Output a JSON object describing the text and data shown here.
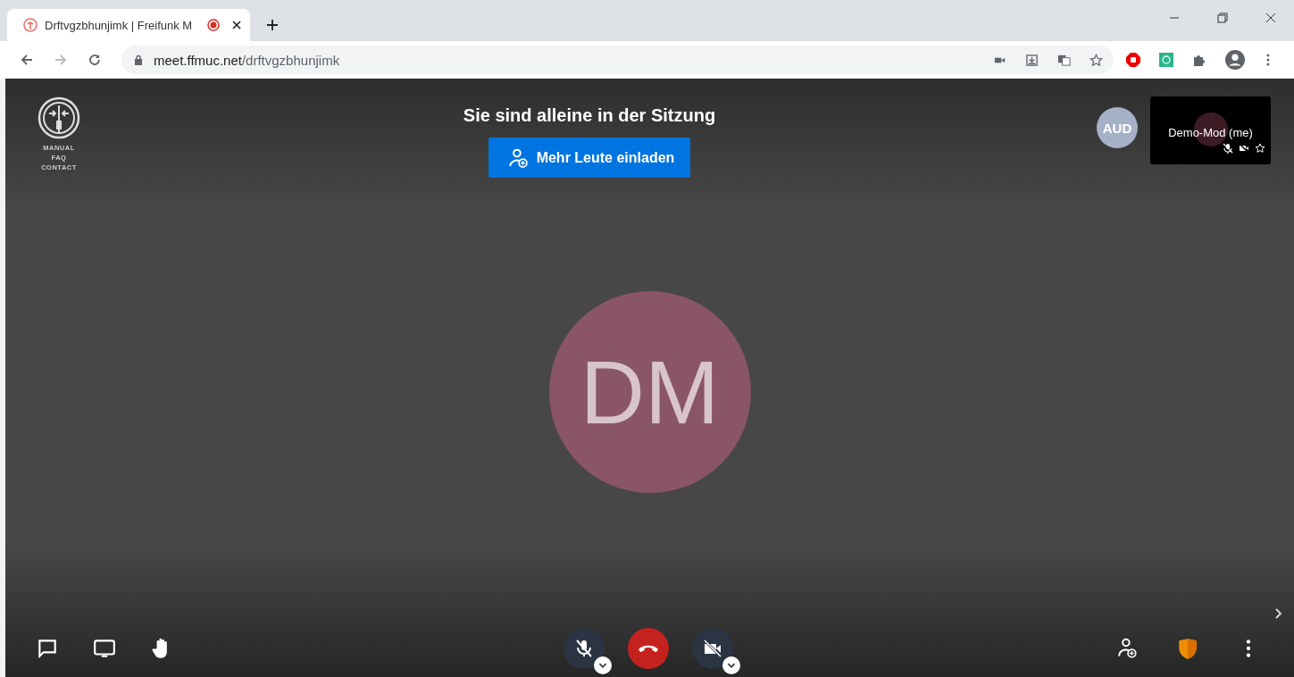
{
  "browser": {
    "tab": {
      "title": "Drftvgzbhunjimk | Freifunk M",
      "recording": true
    },
    "url": {
      "host": "meet.ffmuc.net",
      "path": "/drftvgzbhunjimk"
    }
  },
  "meeting": {
    "logo_links": [
      "MANUAL",
      "FAQ",
      "CONTACT"
    ],
    "notice": "Sie sind alleine in der Sitzung",
    "invite_button": "Mehr Leute einladen",
    "speaker": {
      "initials": "DM",
      "color": "#8a5566"
    },
    "participants": [
      {
        "initials": "AUD",
        "color": "#a5b1c7"
      }
    ],
    "self_tile": {
      "name": "Demo-Mod (me)",
      "muted": true,
      "video_off": true,
      "moderator": true
    },
    "toolbar": {
      "mic_muted": true,
      "camera_off": true
    }
  }
}
